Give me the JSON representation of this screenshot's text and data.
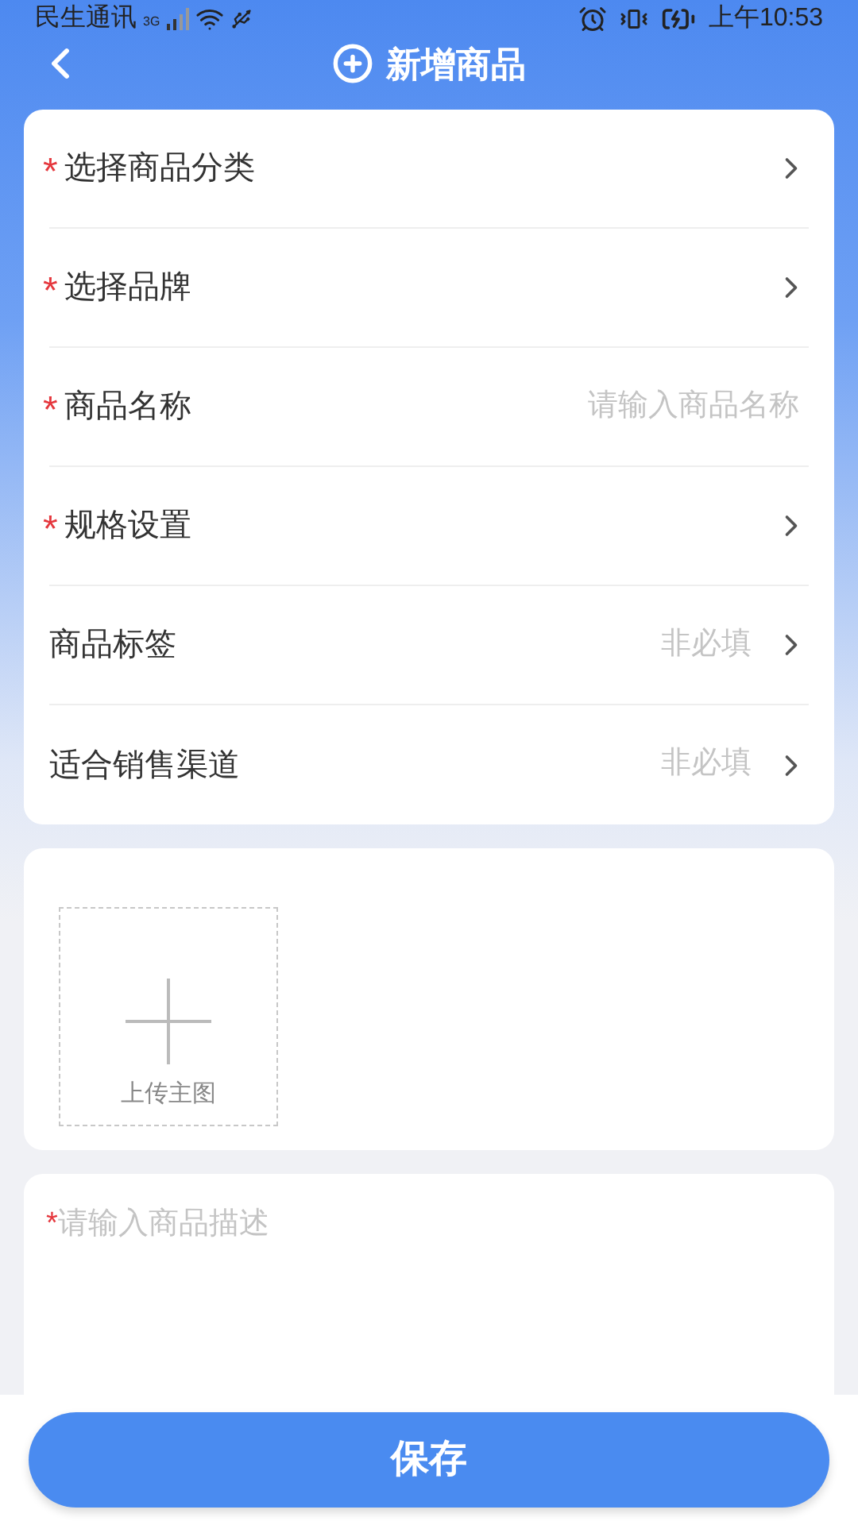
{
  "status_bar": {
    "carrier": "民生通讯",
    "network": "3G",
    "time": "上午10:53"
  },
  "header": {
    "title": "新增商品"
  },
  "form_rows": [
    {
      "kind": "select",
      "required_mark": "*",
      "label": "选择商品分类"
    },
    {
      "kind": "select",
      "required_mark": "*",
      "label": "选择品牌"
    },
    {
      "kind": "input",
      "required_mark": "*",
      "label": "商品名称",
      "placeholder": "请输入商品名称"
    },
    {
      "kind": "select",
      "required_mark": "*",
      "label": "规格设置"
    },
    {
      "kind": "select",
      "label": "商品标签",
      "hint": "非必填"
    },
    {
      "kind": "select",
      "label": "适合销售渠道",
      "hint": "非必填"
    }
  ],
  "upload": {
    "label": "上传主图"
  },
  "description": {
    "required_mark": "*",
    "placeholder": "请输入商品描述"
  },
  "save_button": {
    "label": "保存"
  }
}
